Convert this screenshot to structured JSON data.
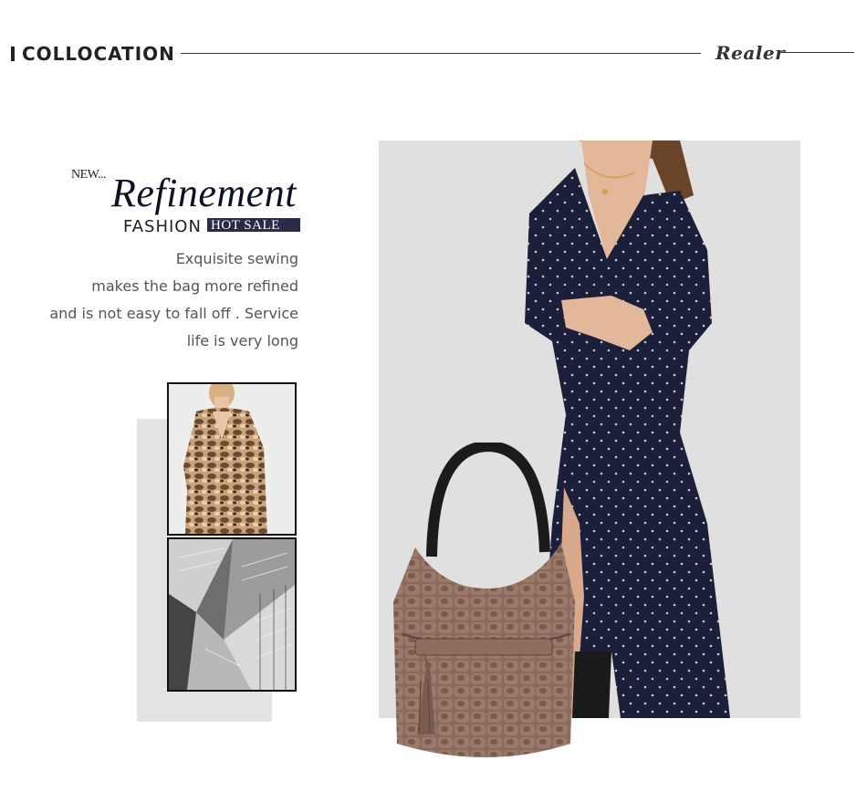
{
  "header": {
    "title": "COLLOCATION",
    "brand": "Realer"
  },
  "promo": {
    "new_tag": "NEW...",
    "headline": "Refinement",
    "fashion_label": "FASHION",
    "hot_sale_label": "HOT SALE",
    "description_lines": [
      "Exquisite sewing",
      "makes the bag more refined",
      "and is not easy to fall off . Service",
      "life is very long"
    ]
  },
  "colors": {
    "headline": "#0f1226",
    "hot_sale_bg": "#2a2b48",
    "dress": "#1c1f3a",
    "bag": "#8a6a5c",
    "backdrop": "#e3e3e3"
  },
  "images": {
    "thumb_top": "snakeskin-dress-photo",
    "thumb_bottom": "architecture-photo",
    "main": "model-with-handbag-photo"
  }
}
